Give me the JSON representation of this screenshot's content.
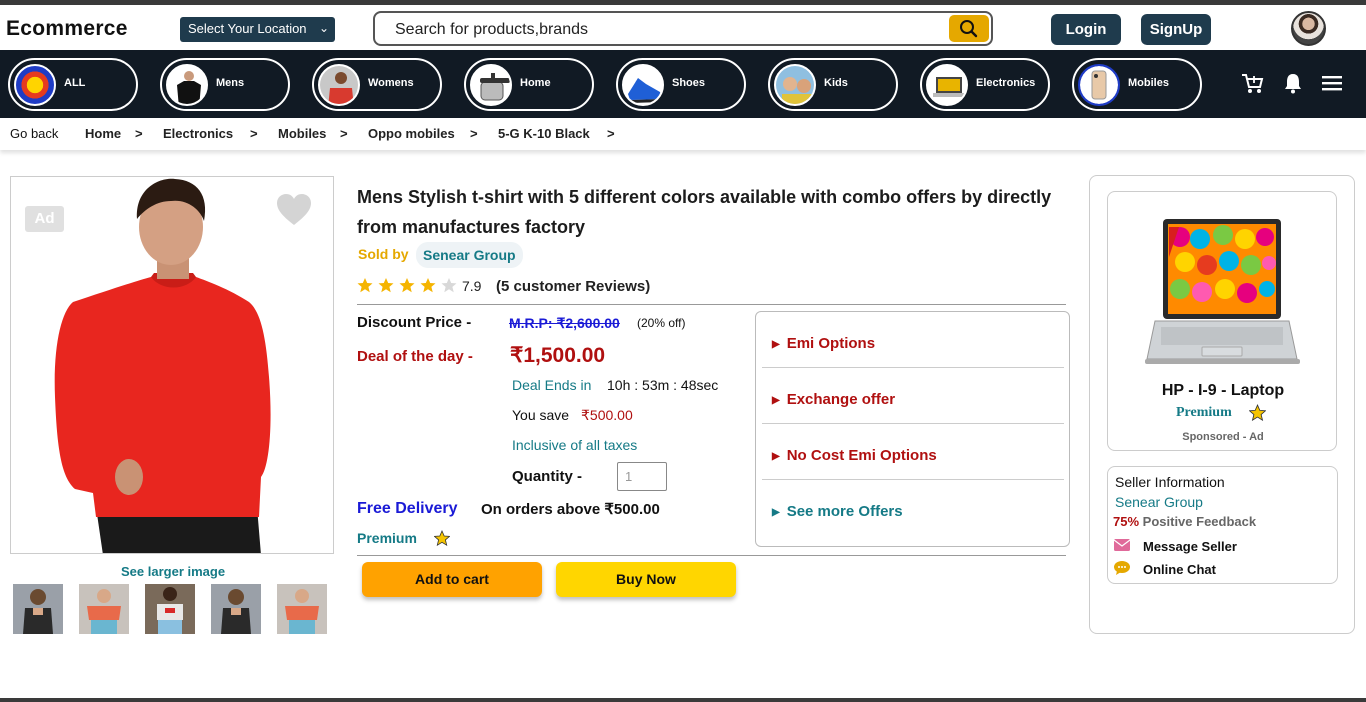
{
  "header": {
    "logo": "Ecommerce",
    "location_select": "Select Your Location",
    "search_placeholder": "Search for products,brands",
    "login": "Login",
    "signup": "SignUp"
  },
  "nav": {
    "categories": [
      {
        "label": "ALL",
        "icon": "all-categories-logo"
      },
      {
        "label": "Mens",
        "icon": "mens-tshirt-photo"
      },
      {
        "label": "Womens",
        "icon": "womens-photo"
      },
      {
        "label": "Home",
        "icon": "pressure-cooker-photo"
      },
      {
        "label": "Shoes",
        "icon": "shoe-photo"
      },
      {
        "label": "Kids",
        "icon": "kids-photo"
      },
      {
        "label": "Electronics",
        "icon": "laptop-photo"
      },
      {
        "label": "Mobiles",
        "icon": "iphone-photo"
      }
    ],
    "icons": [
      "cart-icon",
      "bell-icon",
      "menu-icon"
    ]
  },
  "breadcrumb": {
    "back": "Go back",
    "items": [
      "Home",
      "Electronics",
      "Mobiles",
      "Oppo mobiles",
      "5-G K-10 Black"
    ],
    "separator": ">"
  },
  "gallery": {
    "ad_badge": "Ad",
    "see_larger": "See larger image"
  },
  "product": {
    "title": "Mens Stylish t-shirt with 5 different colors available with combo offers by directly from manufactures factory",
    "sold_by_label": "Sold by",
    "seller": "Senear Group",
    "rating": "7.9",
    "stars_filled": 4,
    "stars_total": 5,
    "reviews": "(5 customer Reviews)",
    "discount_label": "Discount Price -",
    "mrp": "M.R.P: ₹2,600.00",
    "off": "(20% off)",
    "deal_label": "Deal of the day -",
    "deal_price": "₹1,500.00",
    "deal_ends_label": "Deal Ends in",
    "deal_ends_time": "10h : 53m : 48sec",
    "you_save_label": "You save",
    "you_save_value": "₹500.00",
    "taxes": "Inclusive of all taxes",
    "quantity_label": "Quantity -",
    "quantity_value": "1",
    "free_delivery": "Free Delivery",
    "delivery_note": "On orders above ₹500.00",
    "premium": "Premium",
    "add_to_cart": "Add to cart",
    "buy_now": "Buy Now"
  },
  "offers": [
    "Emi Options",
    "Exchange offer",
    "No Cost Emi Options",
    "See more Offers"
  ],
  "sponsored": {
    "name": "HP - I-9 - Laptop",
    "premium": "Premium",
    "tag": "Sponsored - Ad"
  },
  "seller_info": {
    "heading": "Seller Information",
    "name": "Senear Group",
    "feedback_percent": "75%",
    "feedback_label": "Positive Feedback",
    "message": "Message Seller",
    "chat": "Online Chat"
  },
  "colors": {
    "navy": "#1f3b4d",
    "nav_bg": "#111a24",
    "teal": "#157a86",
    "maroon": "#b01010",
    "gold": "#e5a800",
    "orange_btn": "#ffa200",
    "yellow_btn": "#ffd600",
    "blue": "#1a1ad6"
  }
}
